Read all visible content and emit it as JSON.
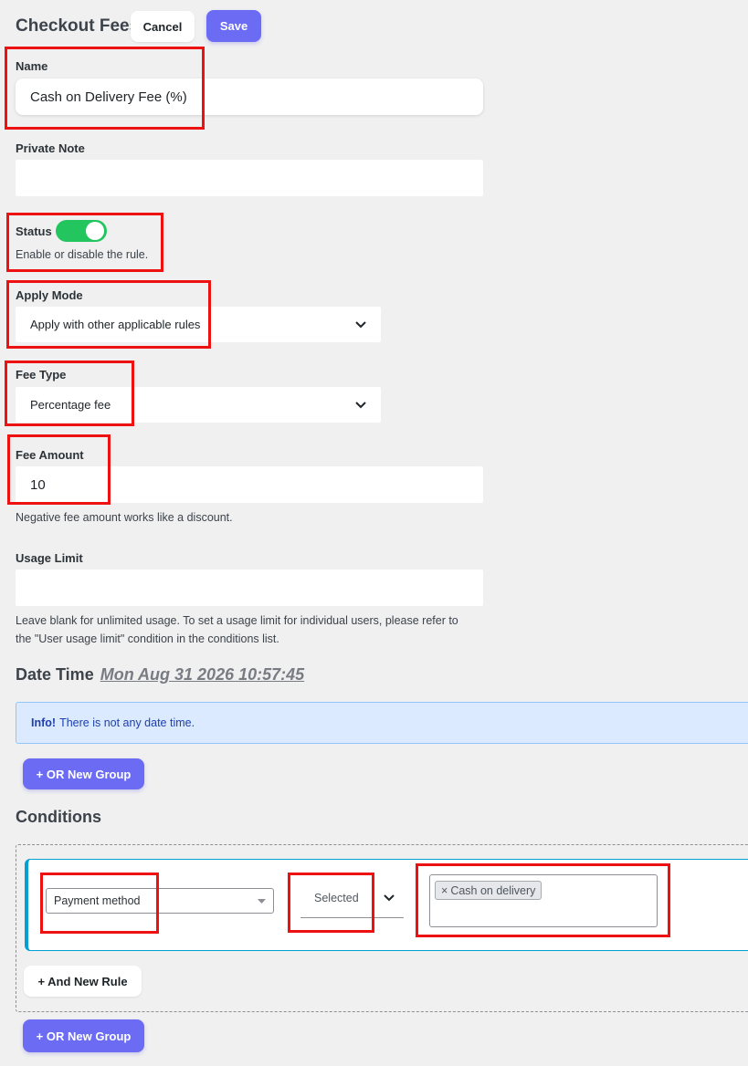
{
  "header": {
    "title": "Checkout Fees",
    "cancel_label": "Cancel",
    "save_label": "Save"
  },
  "fields": {
    "name": {
      "label": "Name",
      "value": "Cash on Delivery Fee (%)"
    },
    "private_note": {
      "label": "Private Note",
      "value": ""
    },
    "status": {
      "label": "Status",
      "enabled": true,
      "help": "Enable or disable the rule."
    },
    "apply_mode": {
      "label": "Apply Mode",
      "value": "Apply with other applicable rules"
    },
    "fee_type": {
      "label": "Fee Type",
      "value": "Percentage fee"
    },
    "fee_amount": {
      "label": "Fee Amount",
      "value": "10",
      "help": "Negative fee amount works like a discount."
    },
    "usage_limit": {
      "label": "Usage Limit",
      "value": "",
      "help_line1": "Leave blank for unlimited usage. To set a usage limit for individual users, please refer to",
      "help_line2": "the \"User usage limit\" condition in the conditions list."
    }
  },
  "date_time": {
    "heading": "Date Time",
    "value": "Mon Aug 31 2026 10:57:45",
    "info_label": "Info!",
    "info_text": "There is not any date time.",
    "add_group_label": "+ OR New Group"
  },
  "conditions": {
    "heading": "Conditions",
    "rule": {
      "type": "Payment method",
      "operator": "Selected",
      "chip_remove": "×",
      "chip_label": "Cash on delivery"
    },
    "add_rule_label": "+ And New Rule",
    "add_group_label": "+ OR New Group"
  },
  "colors": {
    "accent": "#6b6bf3",
    "toggle_on": "#22c55e",
    "highlight": "#e11111",
    "info_bg": "#dbeafe"
  }
}
